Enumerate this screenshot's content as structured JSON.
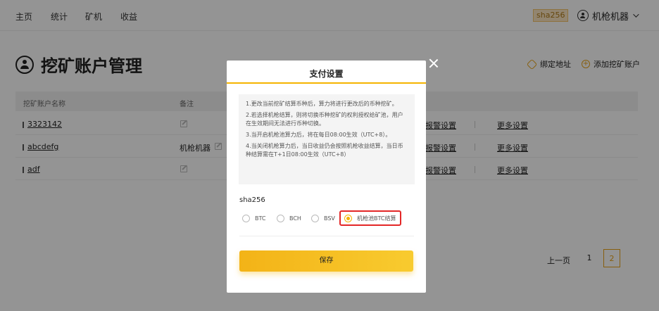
{
  "topnav": {
    "items": [
      "主页",
      "统计",
      "矿机",
      "收益"
    ],
    "algorithm_badge": "sha256",
    "account_name": "机枪机器"
  },
  "header": {
    "title": "挖矿账户管理",
    "bind_address": "绑定地址",
    "add_account": "添加挖矿账户"
  },
  "table": {
    "columns": [
      "挖矿账户名称",
      "备注"
    ],
    "rows": [
      {
        "account": "3323142",
        "remark": "",
        "alarm": "报警设置",
        "more": "更多设置"
      },
      {
        "account": "abcdefg",
        "remark": "机枪机器",
        "alarm": "报警设置",
        "more": "更多设置"
      },
      {
        "account": "adf",
        "remark": "",
        "alarm": "报警设置",
        "more": "更多设置"
      }
    ]
  },
  "pagination": {
    "prev": "上一页",
    "pages": [
      "1",
      "2"
    ],
    "current": "2"
  },
  "modal": {
    "title": "支付设置",
    "notes": [
      "1.更改当前挖矿结算币种后，算力将进行更改后的币种挖矿。",
      "2.若选择机枪结算，则将切换币种挖矿的权利授权给矿池，用户在生效期间无法进行币种切换。",
      "3.当开启机枪池算力后，将在每日08:00生效（UTC+8）。",
      "4.当关闭机枪算力后，当日收益仍会按照机枪收益结算，当日币种结算需在T+1日08:00生效（UTC+8）"
    ],
    "algorithm": "sha256",
    "options": [
      "BTC",
      "BCH",
      "BSV",
      "机枪池BTC结算"
    ],
    "selected": "机枪池BTC结算",
    "save": "保存"
  },
  "colors": {
    "accent": "#f5b400",
    "highlight_border": "#e32727"
  }
}
